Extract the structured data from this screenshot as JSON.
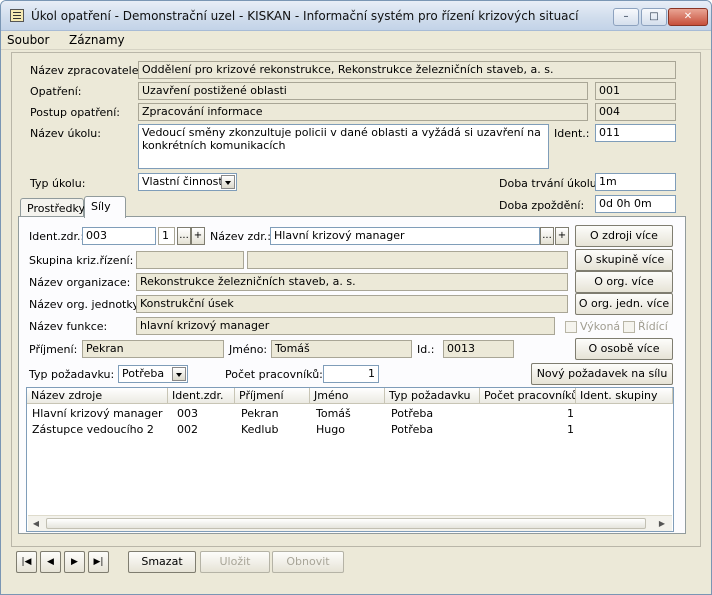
{
  "window": {
    "title": "Úkol opatření - Demonstrační uzel - KISKAN - Informační systém pro řízení krizových situací",
    "minimize": "–",
    "maximize": "□",
    "close": "✕"
  },
  "menu": [
    "Soubor",
    "Záznamy"
  ],
  "header_form": {
    "nazev_zpracovatele": {
      "label": "Název zpracovatele:",
      "value": "Oddělení pro krizové rekonstrukce, Rekonstrukce železničních staveb, a. s."
    },
    "opatreni": {
      "label": "Opatření:",
      "value": "Uzavření postižené oblasti",
      "code": "001"
    },
    "postup": {
      "label": "Postup opatření:",
      "value": "Zpracování informace",
      "code": "004"
    },
    "nazev_ukolu": {
      "label": "Název úkolu:",
      "value": "Vedoucí směny zkonzultuje policii v dané oblasti a vyžádá si uzavření na konkrétních komunikacích"
    },
    "ident": {
      "label": "Ident.:",
      "value": "011"
    },
    "typ_ukolu": {
      "label": "Typ úkolu:",
      "value": "Vlastní činnost"
    },
    "doba_trvani": {
      "label": "Doba trvání úkolu:",
      "value": "1m"
    },
    "doba_zpozdeni": {
      "label": "Doba zpoždění:",
      "value": "0d 0h 0m"
    }
  },
  "tabs": [
    {
      "label": "Prostředky",
      "active": false
    },
    {
      "label": "Síly",
      "active": true
    }
  ],
  "sily": {
    "ident_zdr": {
      "label": "Ident.zdr.:",
      "value": "003",
      "count": "1"
    },
    "ellipsis": "...",
    "plus": "+",
    "nazev_zdr": {
      "label": "Název zdr.:",
      "value": "Hlavní krizový manager"
    },
    "skupina": {
      "label": "Skupina kriz.řízení:",
      "value1": "",
      "value2": ""
    },
    "organizace": {
      "label": "Název organizace:",
      "value": "Rekonstrukce železničních staveb, a. s."
    },
    "org_jednotka": {
      "label": "Název org. jednotky:",
      "value": "Konstrukční úsek"
    },
    "funkce": {
      "label": "Název funkce:",
      "value": "hlavní krizový manager"
    },
    "vykona": "Výkoná",
    "ridici": "Řídící",
    "prijmeni": {
      "label": "Příjmení:",
      "value": "Pekran"
    },
    "jmeno": {
      "label": "Jméno:",
      "value": "Tomáš"
    },
    "id": {
      "label": "Id.:",
      "value": "0013"
    },
    "typ_pozadavku": {
      "label": "Typ požadavku:",
      "value": "Potřeba"
    },
    "pocet_pracovniku": {
      "label": "Počet pracovníků:",
      "value": "1"
    },
    "buttons": {
      "o_zdroji": "O zdroji více",
      "o_skupine": "O skupině více",
      "o_org": "O org. více",
      "o_org_jedn": "O org. jedn. více",
      "o_osobe": "O osobě více",
      "novy_pozadavek": "Nový požadavek na sílu"
    }
  },
  "grid": {
    "columns": [
      "Název zdroje",
      "Ident.zdr.",
      "Příjmení",
      "Jméno",
      "Typ požadavku",
      "Počet pracovníků",
      "Ident. skupiny"
    ],
    "rows": [
      [
        "Hlavní krizový manager",
        "003",
        "Pekran",
        "Tomáš",
        "Potřeba",
        "1",
        ""
      ],
      [
        "Zástupce vedoucího 2",
        "002",
        "Kedlub",
        "Hugo",
        "Potřeba",
        "1",
        ""
      ]
    ]
  },
  "nav": {
    "first": "|◀",
    "prev": "◀",
    "next": "▶",
    "last": "▶|",
    "smazat": "Smazat",
    "ulozit": "Uložit",
    "obnovit": "Obnovit"
  },
  "scroll": {
    "left": "◀",
    "right": "▶"
  }
}
